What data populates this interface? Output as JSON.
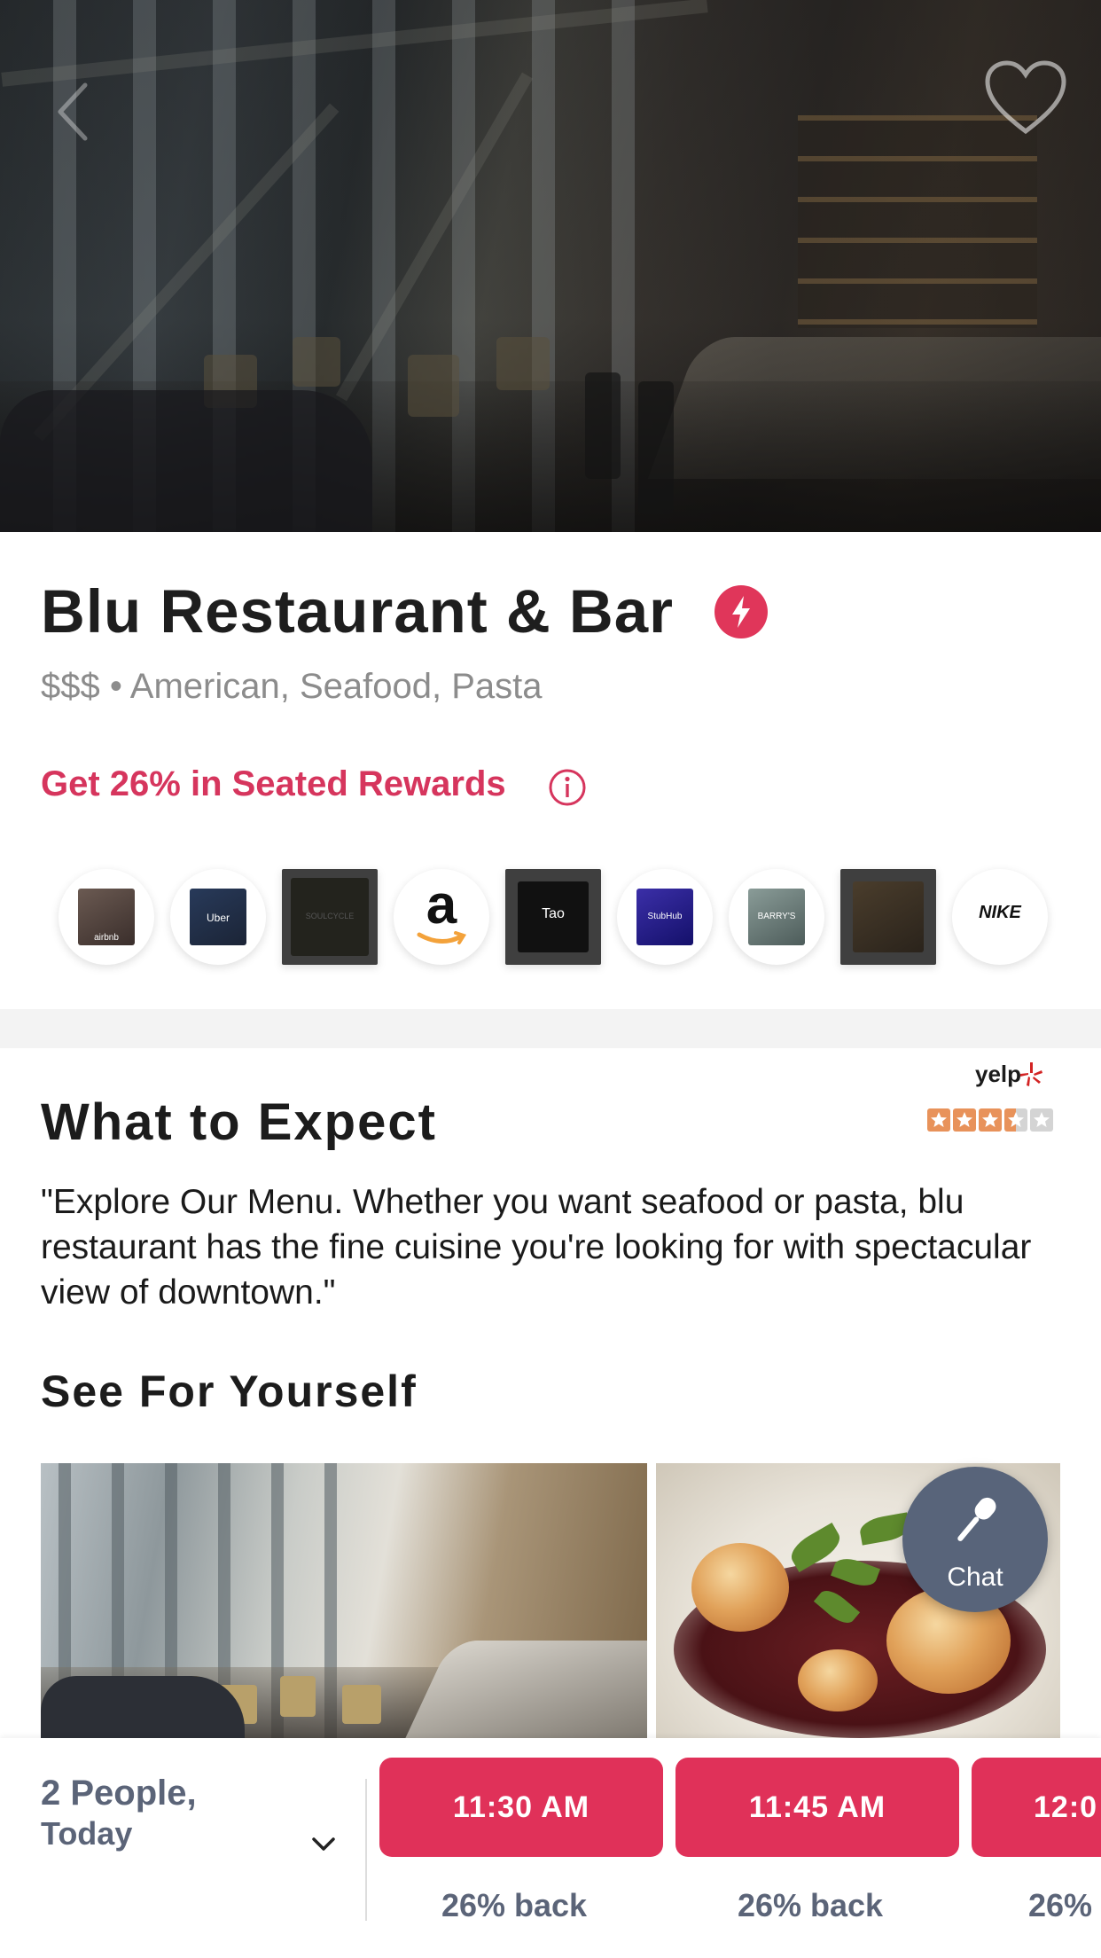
{
  "restaurant": {
    "name": "Blu Restaurant & Bar",
    "price": "$$$",
    "separator": "•",
    "cuisines": "American, Seafood, Pasta",
    "rewards_text": "Get 26% in Seated Rewards",
    "accent_color": "#e0365a"
  },
  "brands": [
    {
      "name": "airbnb",
      "caption": "airbnb"
    },
    {
      "name": "uber",
      "caption": "Uber"
    },
    {
      "name": "soulcycle",
      "caption": "SOULCYCLE"
    },
    {
      "name": "amazon",
      "caption": "a"
    },
    {
      "name": "tao",
      "caption": "Tao"
    },
    {
      "name": "stubhub",
      "caption": "StubHub"
    },
    {
      "name": "barrys",
      "caption": "BARRY'S"
    },
    {
      "name": "venue",
      "caption": ""
    },
    {
      "name": "nike",
      "caption": "NIKE"
    }
  ],
  "expect": {
    "heading": "What to Expect",
    "rating_source": "yelp",
    "rating": 3.5,
    "rating_max": 5,
    "description": "\"Explore Our Menu. Whether you want seafood or pasta, blu restaurant has the fine cuisine you're looking for with spectacular view of downtown.\""
  },
  "gallery": {
    "heading": "See For Yourself"
  },
  "chat": {
    "label": "Chat"
  },
  "booking": {
    "party_line1": "2 People,",
    "party_line2": "Today",
    "slots": [
      {
        "time": "11:30 AM",
        "back": "26% back"
      },
      {
        "time": "11:45 AM",
        "back": "26% back"
      },
      {
        "time": "12:0",
        "back": "26%"
      }
    ],
    "slot_color": "#e03159"
  }
}
